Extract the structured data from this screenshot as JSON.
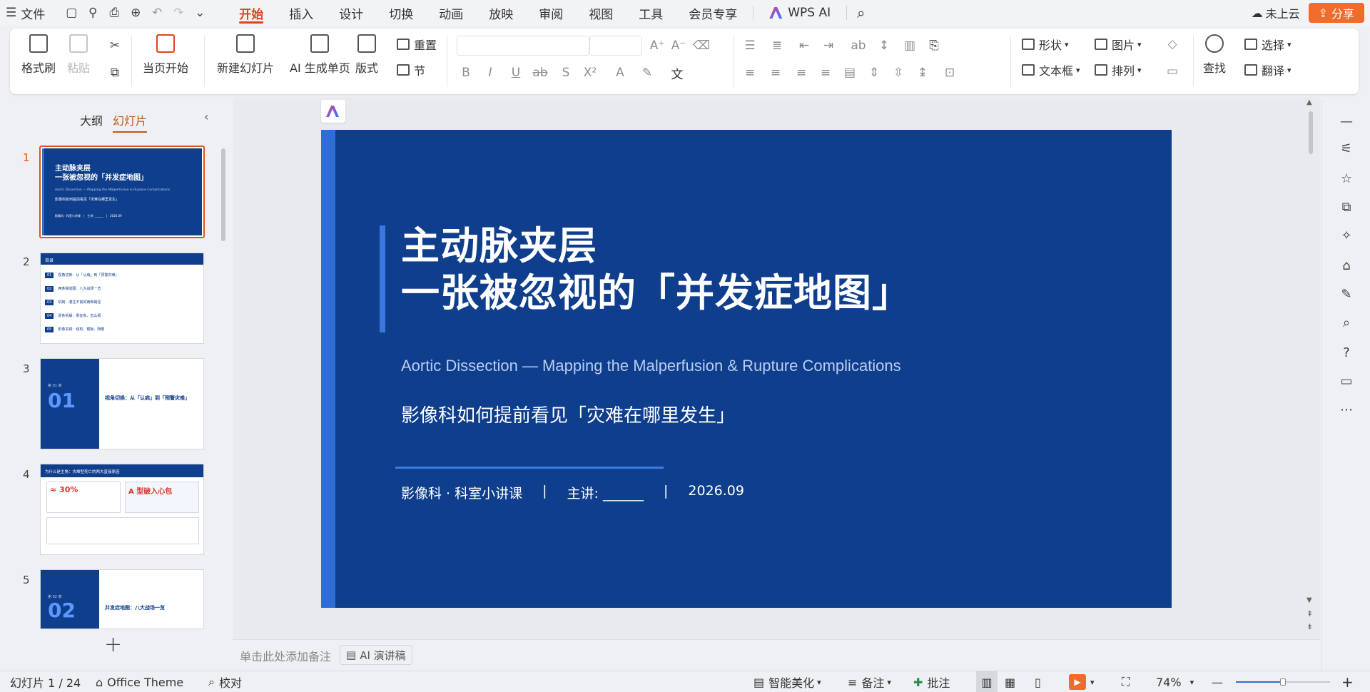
{
  "menubar": {
    "file_label": "文件",
    "tabs": [
      "开始",
      "插入",
      "设计",
      "切换",
      "动画",
      "放映",
      "审阅",
      "视图",
      "工具",
      "会员专享"
    ],
    "active_tab": "开始",
    "wps_ai": "WPS AI",
    "cloud": "未上云",
    "share": "分享"
  },
  "ribbon": {
    "format_painter": "格式刷",
    "paste": "粘贴",
    "play_from_current": "当页开始",
    "new_slide": "新建幻灯片",
    "ai_generate": "AI 生成单页",
    "layout": "版式",
    "reset": "重置",
    "section": "节",
    "shape": "形状",
    "picture": "图片",
    "textbox": "文本框",
    "arrange": "排列",
    "find": "查找",
    "select": "选择",
    "translate": "翻译"
  },
  "leftpanel": {
    "tab_outline": "大纲",
    "tab_slides": "幻灯片",
    "thumbs": [
      {
        "num": "1",
        "title": "主动脉夹层",
        "title2": "一张被忽视的「并发症地图」",
        "sub": "Aortic Dissection — Mapping the Malperfusion & Rupture Complications",
        "cn": "影像科如何提前看见「灾难在哪里发生」",
        "foot": "影像科 · 科室小讲课　|　主讲: ______　|　2026.09"
      },
      {
        "num": "2",
        "title": "目录",
        "items": [
          "视角切换：从「认病」到「预警灾难」",
          "两条弹道图：八大战场一览",
          "机制：灌注不良的两种路径",
          "逐条拆解：看征象、怎么报",
          "影像实践：结构、模板、随着"
        ]
      },
      {
        "num": "3",
        "section": "第 01 章",
        "big": "01",
        "title": "视角切换：从「认病」到「预警灾难」"
      },
      {
        "num": "4",
        "title": "为什么是主角：灾难型死亡的两大直接原因",
        "stat": "≈ 30%",
        "stat2": "A 型破入心包"
      },
      {
        "num": "5",
        "section": "第 02 章",
        "big": "02",
        "title": "并发症地图：八大战场一览"
      }
    ]
  },
  "slide": {
    "title_line1": "主动脉夹层",
    "title_line2": "一张被忽视的「并发症地图」",
    "subtitle_en": "Aortic Dissection — Mapping the Malperfusion & Rupture Complications",
    "subtitle_cn": "影像科如何提前看见「灾难在哪里发生」",
    "footer_dept": "影像科 · 科室小讲课",
    "footer_sep1": "|",
    "footer_speaker": "主讲: ______",
    "footer_sep2": "|",
    "footer_date": "2026.09"
  },
  "notes": {
    "placeholder": "单击此处添加备注",
    "ai_notes": "AI 演讲稿"
  },
  "statusbar": {
    "slide_count": "幻灯片 1 / 24",
    "theme": "Office Theme",
    "proof": "校对",
    "smart": "智能美化",
    "notes": "备注",
    "comment": "批注",
    "zoom": "74%"
  },
  "colors": {
    "accent": "#e2421d",
    "slide_bg": "#0e3e8c",
    "slide_accent": "#3a78e0",
    "share_bg": "#f26b2a"
  }
}
